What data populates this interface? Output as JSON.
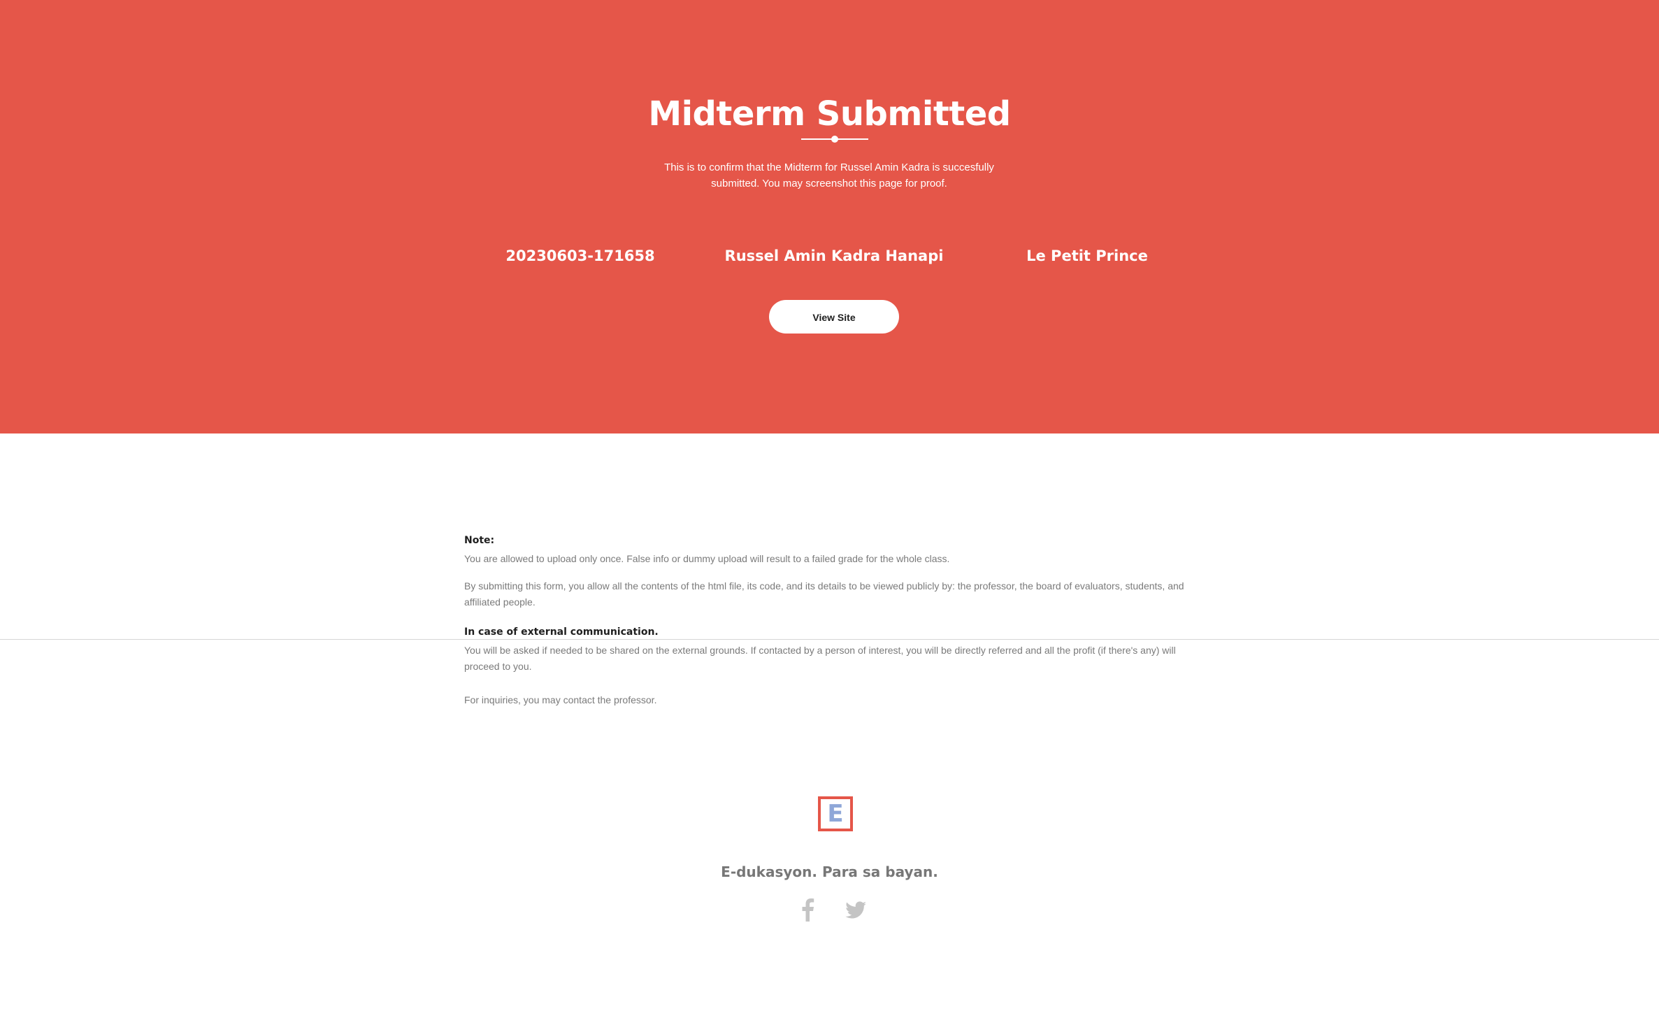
{
  "hero": {
    "title": "Midterm Submitted",
    "description": "This is to confirm that the Midterm for Russel Amin Kadra is succesfully submitted. You may screenshot this page for proof.",
    "stats": {
      "code": "20230603-171658",
      "name": "Russel Amin Kadra Hanapi",
      "book": "Le Petit Prince"
    },
    "button_label": "View Site"
  },
  "notes": {
    "note_heading": "Note:",
    "note_p1": "You are allowed to upload only once. False info or dummy upload will result to a failed grade for the whole class.",
    "note_p2": "By submitting this form, you allow all the contents of the html file, its code, and its details to be viewed publicly by: the professor, the board of evaluators, students, and affiliated people.",
    "external_heading": "In case of external communication.",
    "external_p": "You will be asked if needed to be shared on the external grounds. If contacted by a person of interest, you will be directly referred and all the profit (if there's any) will proceed to you.",
    "inquiries": "For inquiries, you may contact the professor."
  },
  "footer": {
    "logo_letter": "E",
    "tagline": "E-dukasyon. Para sa bayan.",
    "social": [
      "facebook-icon",
      "twitter-icon"
    ]
  },
  "colors": {
    "brand": "#e55649",
    "logo_letter": "#8fa7d8",
    "muted_text": "#7a7a7a",
    "social_icons": "#c4c4c4"
  }
}
